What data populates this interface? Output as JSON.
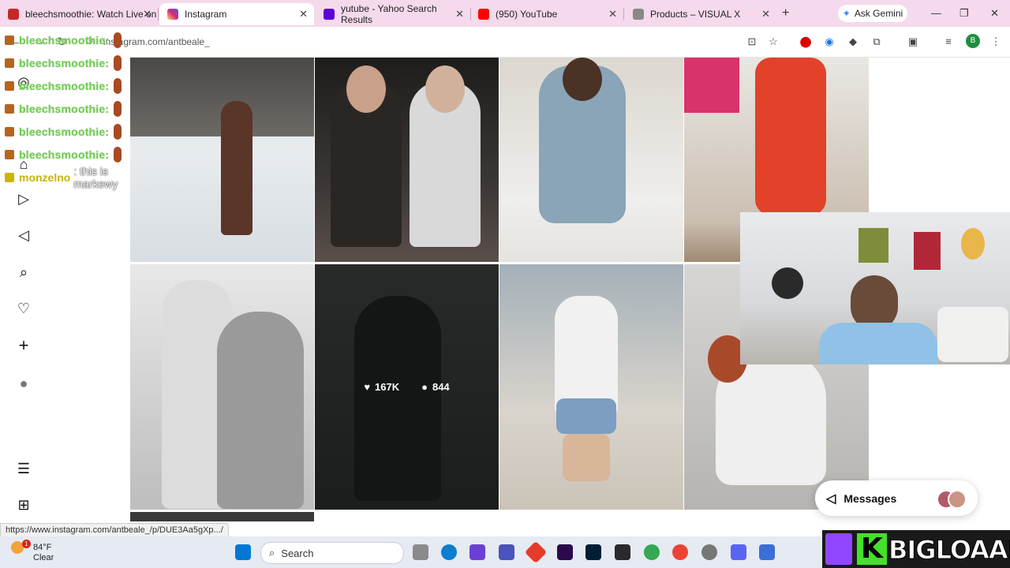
{
  "browser": {
    "tabs": [
      {
        "label": "bleechsmoothie: Watch Live on",
        "active": false,
        "fav_color": "#c62828"
      },
      {
        "label": "Instagram",
        "active": true,
        "fav_color": "#d6249f"
      },
      {
        "label": "yutube - Yahoo Search Results",
        "active": false,
        "fav_color": "#5f01d1"
      },
      {
        "label": "(950) YouTube",
        "active": false,
        "fav_color": "#ff0000"
      },
      {
        "label": "Products – VISUAL X",
        "active": false,
        "fav_color": "#888888"
      }
    ],
    "gemini_label": "Ask Gemini",
    "url": "instagram.com/antbeale_",
    "profile_initial": "B"
  },
  "chat": {
    "lines": [
      {
        "user": "bleechsmoothie:",
        "msg": ""
      },
      {
        "user": "bleechsmoothie:",
        "msg": ""
      },
      {
        "user": "bleechsmoothie:",
        "msg": ""
      },
      {
        "user": "bleechsmoothie:",
        "msg": ""
      },
      {
        "user": "bleechsmoothie:",
        "msg": ""
      },
      {
        "user": "bleechsmoothie:",
        "msg": ""
      }
    ],
    "last": {
      "user": "monzelno",
      "msg": ": this is markewy"
    }
  },
  "grid": {
    "hover_stats": {
      "likes": "167K",
      "comments": "844"
    }
  },
  "messages": {
    "label": "Messages"
  },
  "status_url": "https://www.instagram.com/antbeale_/p/DUE3Aa5gXp.../",
  "taskbar": {
    "weather_temp": "84°F",
    "weather_desc": "Clear",
    "search_placeholder": "Search",
    "notification_badge": "1"
  },
  "stream": {
    "channel": "BIGLOAAF",
    "k_letter": "K"
  }
}
